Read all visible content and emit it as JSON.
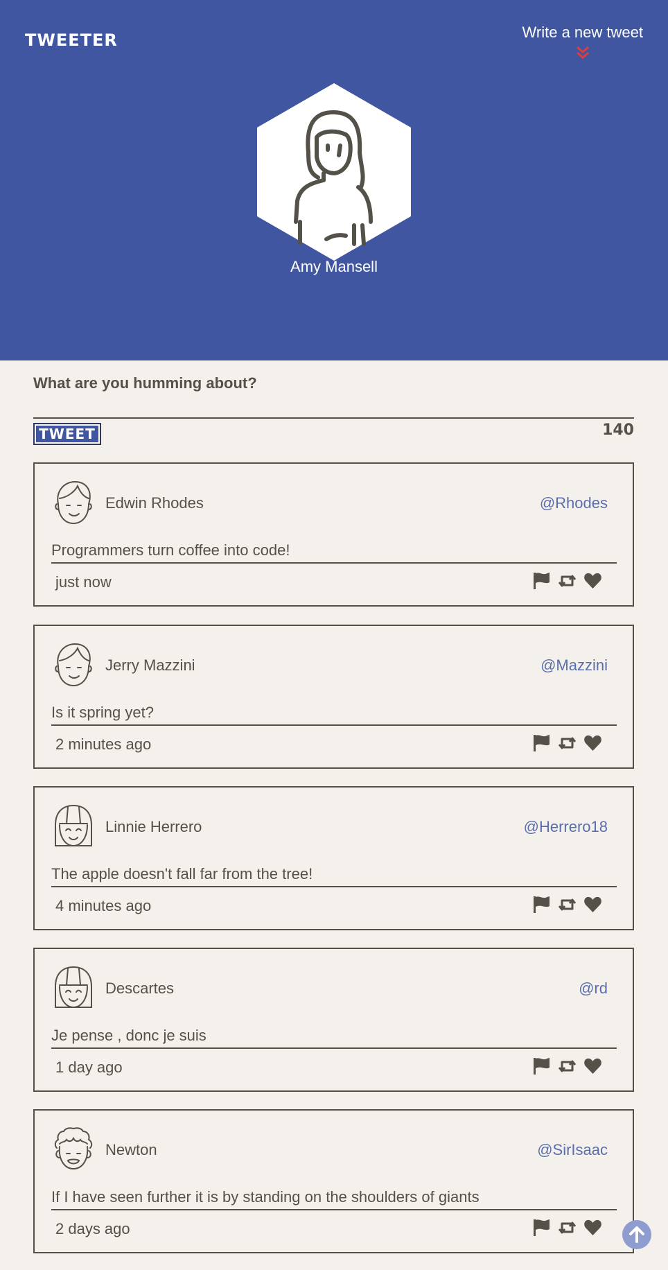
{
  "header": {
    "logo": "TWEETER",
    "compose_toggle_label": "Write a new tweet",
    "profile_name": "Amy Mansell"
  },
  "compose": {
    "question": "What are you humming about?",
    "input_value": "",
    "button_label": "TWEET",
    "counter": "140"
  },
  "colors": {
    "header_bg": "#4056a1",
    "page_bg": "#f4f1ec",
    "text": "#545149",
    "handle": "#4056a1",
    "chevron": "#e23b3b"
  },
  "tweets": [
    {
      "name": "Edwin Rhodes",
      "handle": "@Rhodes",
      "text": "Programmers turn coffee into code!",
      "time": "just now",
      "avatar_icon": "male-face-icon"
    },
    {
      "name": "Jerry Mazzini",
      "handle": "@Mazzini",
      "text": "Is it spring yet?",
      "time": "2 minutes ago",
      "avatar_icon": "male-face-icon"
    },
    {
      "name": "Linnie Herrero",
      "handle": "@Herrero18",
      "text": "The apple doesn't fall far from the tree!",
      "time": "4 minutes ago",
      "avatar_icon": "female-face-icon"
    },
    {
      "name": "Descartes",
      "handle": "@rd",
      "text": "Je pense , donc je suis",
      "time": "1 day ago",
      "avatar_icon": "female-face-icon"
    },
    {
      "name": "Newton",
      "handle": "@SirIsaac",
      "text": "If I have seen further it is by standing on the shoulders of giants",
      "time": "2 days ago",
      "avatar_icon": "curly-hair-face-icon"
    }
  ],
  "icons": {
    "flag": "flag-icon",
    "retweet": "retweet-icon",
    "like": "heart-icon",
    "scroll_top": "arrow-up-icon"
  }
}
